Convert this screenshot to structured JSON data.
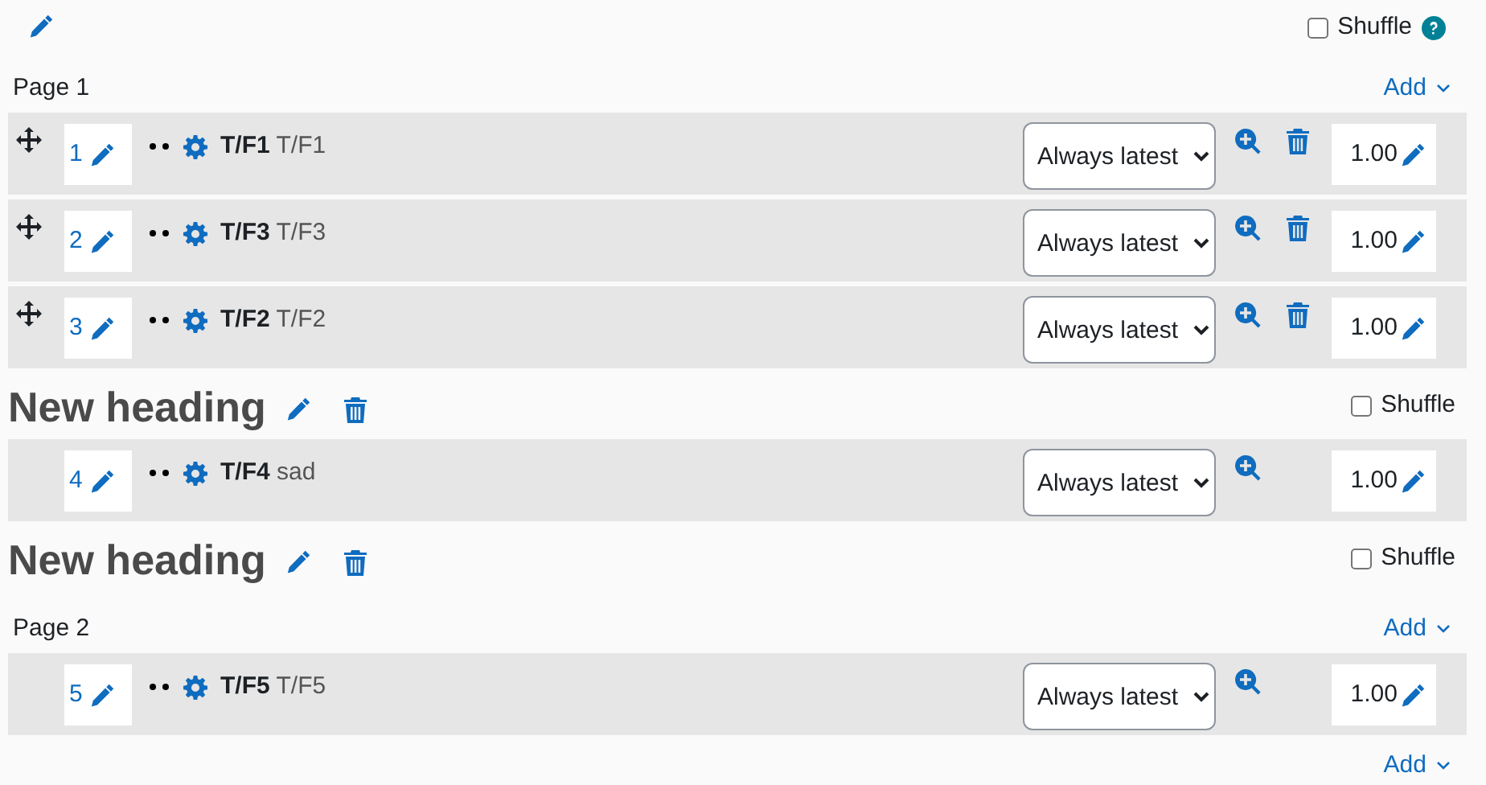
{
  "top": {
    "shuffle": {
      "label": "Shuffle",
      "checked": false
    }
  },
  "blocks": [
    {
      "kind": "page",
      "label": "Page 1",
      "add": "Add"
    },
    {
      "kind": "slot",
      "number": "1",
      "name": "T/F1",
      "text": "T/F1",
      "version": "Always latest",
      "mark": "1.00",
      "movable": true,
      "deletable": true
    },
    {
      "kind": "slot",
      "number": "2",
      "name": "T/F3",
      "text": "T/F3",
      "version": "Always latest",
      "mark": "1.00",
      "movable": true,
      "deletable": true
    },
    {
      "kind": "slot",
      "number": "3",
      "name": "T/F2",
      "text": "T/F2",
      "version": "Always latest",
      "mark": "1.00",
      "movable": true,
      "deletable": true
    },
    {
      "kind": "heading",
      "label": "New heading",
      "shuffle": {
        "label": "Shuffle",
        "checked": false
      }
    },
    {
      "kind": "slot",
      "number": "4",
      "name": "T/F4",
      "text": "sad",
      "version": "Always latest",
      "mark": "1.00",
      "movable": false,
      "deletable": false
    },
    {
      "kind": "heading",
      "label": "New heading",
      "shuffle": {
        "label": "Shuffle",
        "checked": false
      }
    },
    {
      "kind": "page",
      "label": "Page 2",
      "add": "Add"
    },
    {
      "kind": "slot",
      "number": "5",
      "name": "T/F5",
      "text": "T/F5",
      "version": "Always latest",
      "mark": "1.00",
      "movable": false,
      "deletable": false
    }
  ],
  "footer_add": "Add"
}
